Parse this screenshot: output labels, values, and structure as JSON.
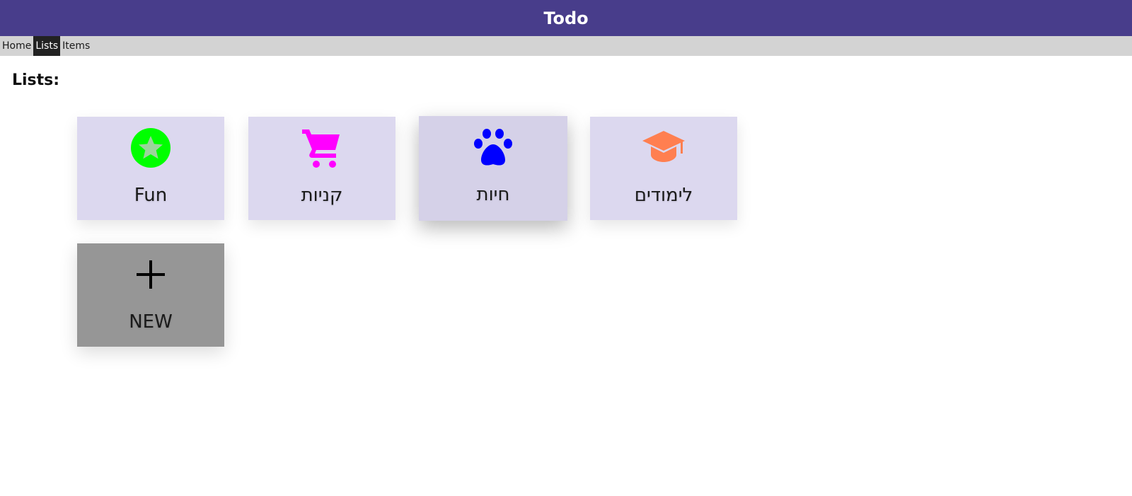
{
  "app": {
    "title": "Todo"
  },
  "nav": {
    "items": [
      "Home",
      "Lists",
      "Items"
    ],
    "active": "Lists"
  },
  "page": {
    "heading": "Lists:"
  },
  "lists": [
    {
      "label": "Fun",
      "icon": "star-icon",
      "color": "#00ff00"
    },
    {
      "label": "קניות",
      "icon": "shopping-cart-icon",
      "color": "#ff00ff"
    },
    {
      "label": "חיות",
      "icon": "paw-icon",
      "color": "#0000ff"
    },
    {
      "label": "לימודים",
      "icon": "graduation-cap-icon",
      "color": "#ff7f50"
    }
  ],
  "new_card": {
    "label": "NEW",
    "icon": "plus-icon"
  },
  "colors": {
    "header": "#483d8b",
    "nav": "#d3d3d3",
    "card": "#dcd8ef",
    "new_card": "#969696"
  }
}
